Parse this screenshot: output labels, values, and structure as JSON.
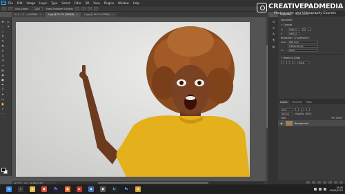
{
  "menubar": {
    "app_logo": "Ps",
    "items": [
      "File",
      "Edit",
      "Image",
      "Layer",
      "Type",
      "Select",
      "Filter",
      "3D",
      "View",
      "Plugins",
      "Window",
      "Help"
    ]
  },
  "options_bar": {
    "auto_select_label": "Auto-Select:",
    "auto_select_value": "Layer",
    "transform_controls_label": "Show Transform Controls"
  },
  "document_tabs": [
    {
      "label": "5 (1, 1.5 ...) (RGB/8)",
      "active": false
    },
    {
      "label": "1.jpg @ 22.7% (RGB/8)",
      "active": true
    },
    {
      "label": "1.jpg @ 16.7% (RGB/8)",
      "active": false
    }
  ],
  "toolbar": {
    "left_tools": [
      "move-tool",
      "marquee-tool",
      "lasso-tool",
      "crop-tool",
      "eyedropper-tool",
      "healing-tool",
      "brush-tool",
      "stamp-tool",
      "history-brush-tool",
      "eraser-tool",
      "gradient-tool",
      "blur-tool",
      "dodge-tool",
      "pen-tool",
      "type-tool",
      "path-select-tool",
      "shape-tool",
      "hand-tool",
      "zoom-tool"
    ],
    "foreground_color": "#000000",
    "background_color": "#ffffff"
  },
  "status_bar": {
    "zoom": "22.73%",
    "doc_info": "Doc: 14.4M/14.4M"
  },
  "right_panel": {
    "tabs": [
      "Properties",
      "Adjustments"
    ],
    "document_label": "Document",
    "canvas_heading": "Canvas",
    "width_label": "W",
    "width_value": "3760 px",
    "height_label": "H",
    "height_value": "2000 px",
    "resolution_label": "Resolution: 72 pixels/inch",
    "mode_label": "Mode",
    "mode_value": "RGB Color",
    "depth_value": "8 Bits/Channel",
    "fill_label": "Fill",
    "fill_value": "White",
    "rulers_heading": "Rulers & Grids",
    "units_value": "Pixels"
  },
  "layers_panel": {
    "tabs": [
      "Layers",
      "Channels",
      "Paths"
    ],
    "kind_label": "Kind",
    "blend_mode": "Normal",
    "opacity_label": "Opacity: 100%",
    "lock_label": "Lock:",
    "fill_label": "Fill: 100%",
    "layer_name": "Background"
  },
  "watermark": {
    "title": "CREATIVEPADMEDIA",
    "subtitle": "Photography and Videography Courses"
  },
  "taskbar": {
    "apps": [
      {
        "name": "start-icon",
        "color": "#3a8ee6",
        "glyph": "⊞"
      },
      {
        "name": "search-icon",
        "color": "#3a3a3a",
        "glyph": "⌕"
      },
      {
        "name": "files-icon",
        "color": "#e8b84a",
        "glyph": "▰"
      },
      {
        "name": "chrome-icon",
        "color": "#e04a3a",
        "glyph": "●"
      },
      {
        "name": "premiere-icon",
        "color": "#2a1a4a",
        "glyph": "Pr"
      },
      {
        "name": "firefox-icon",
        "color": "#e8722a",
        "glyph": "●"
      },
      {
        "name": "media-icon",
        "color": "#c0392b",
        "glyph": "▶"
      },
      {
        "name": "vpn-icon",
        "color": "#4a6ab0",
        "glyph": "◆"
      },
      {
        "name": "app-icon",
        "color": "#5a5a5a",
        "glyph": "◼"
      },
      {
        "name": "lightroom-icon",
        "color": "#1a2a3a",
        "glyph": "Lr"
      },
      {
        "name": "photoshop-icon",
        "color": "#0d1e33",
        "glyph": "Ps"
      },
      {
        "name": "folder-icon",
        "color": "#d4a63a",
        "glyph": "▬"
      }
    ],
    "time": "16:38",
    "date": "05/09/2023"
  }
}
